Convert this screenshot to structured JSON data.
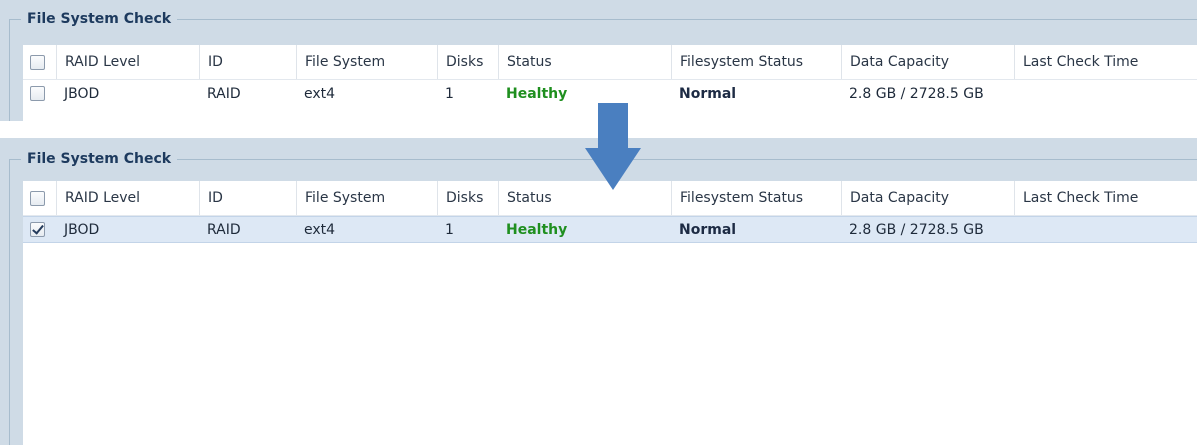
{
  "top_panel": {
    "title": "File System Check",
    "columns": [
      "RAID Level",
      "ID",
      "File System",
      "Disks",
      "Status",
      "Filesystem Status",
      "Data Capacity",
      "Last Check Time"
    ],
    "row": {
      "checked": false,
      "raid_level": "JBOD",
      "id": "RAID",
      "file_system": "ext4",
      "disks": "1",
      "status": "Healthy",
      "filesystem_status": "Normal",
      "data_capacity": "2.8 GB / 2728.5 GB",
      "last_check_time": ""
    }
  },
  "bottom_panel": {
    "title": "File System Check",
    "columns": [
      "RAID Level",
      "ID",
      "File System",
      "Disks",
      "Status",
      "Filesystem Status",
      "Data Capacity",
      "Last Check Time"
    ],
    "row": {
      "checked": true,
      "raid_level": "JBOD",
      "id": "RAID",
      "file_system": "ext4",
      "disks": "1",
      "status": "Healthy",
      "filesystem_status": "Normal",
      "data_capacity": "2.8 GB / 2728.5 GB",
      "last_check_time": ""
    }
  },
  "colors": {
    "status_healthy": "#1f8f1f",
    "panel_background": "#cfdbe6",
    "selected_row": "#dde8f5",
    "arrow": "#4a7fc0"
  },
  "icons": {
    "transition_arrow": "arrow-down-icon"
  }
}
